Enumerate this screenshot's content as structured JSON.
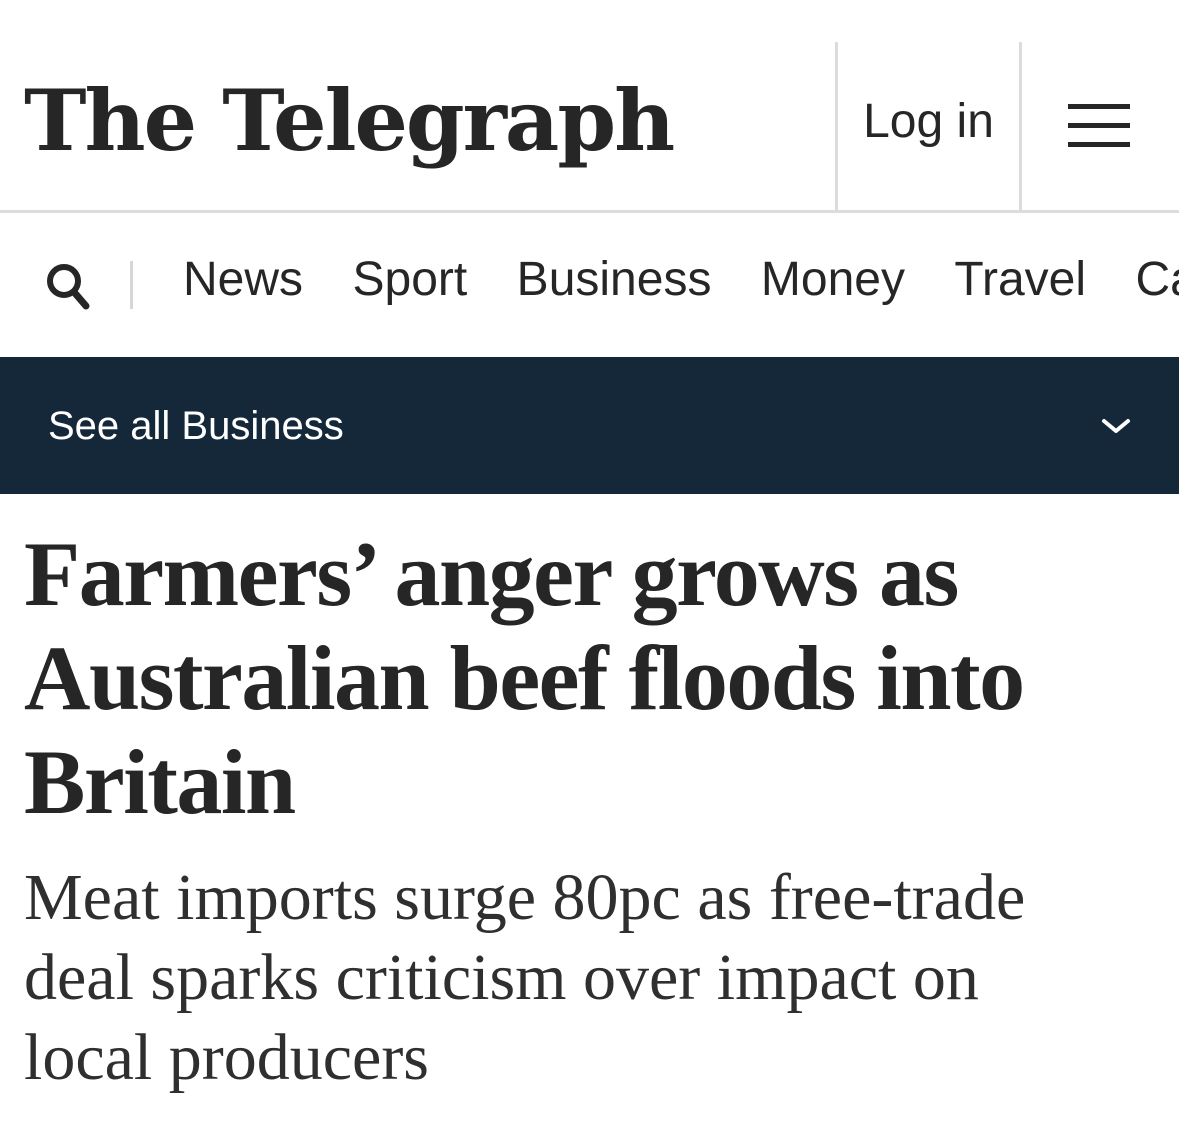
{
  "header": {
    "logo": "The Telegraph",
    "login_label": "Log in",
    "menu_icon": "hamburger-menu-icon"
  },
  "nav": {
    "search_icon": "search-icon",
    "items": [
      {
        "label": "News"
      },
      {
        "label": "Sport"
      },
      {
        "label": "Business"
      },
      {
        "label": "Money"
      },
      {
        "label": "Travel"
      },
      {
        "label": "Ca"
      }
    ]
  },
  "section_banner": {
    "label": "See all Business",
    "icon": "chevron-down-icon",
    "background": "#15283a"
  },
  "article": {
    "headline": "Farmers’ anger grows as Australian beef floods into Britain",
    "standfirst": "Meat imports surge 80pc as free-trade deal sparks criticism over impact on local producers"
  }
}
